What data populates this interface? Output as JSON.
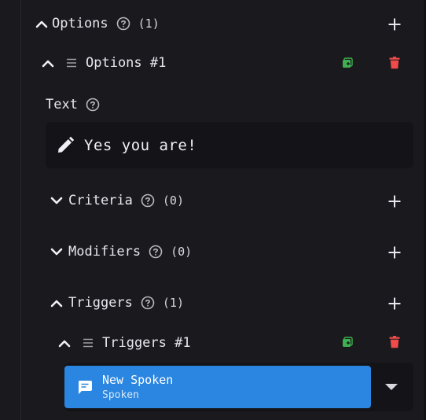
{
  "options": {
    "title": "Options",
    "count": "(1)",
    "icons": {
      "collapse": "chevron-up-icon",
      "help": "help-circle-icon",
      "add": "plus-icon"
    }
  },
  "option_item": {
    "title": "Options #1",
    "icons": {
      "collapse": "chevron-up-icon",
      "drag": "drag-lines-icon",
      "duplicate": "duplicate-icon",
      "delete": "trash-icon"
    },
    "colors": {
      "duplicate": "#3fb04f",
      "delete": "#f04b4b"
    }
  },
  "text_field": {
    "label": "Text",
    "value": "Yes you are!",
    "icon": "pencil-icon"
  },
  "criteria": {
    "title": "Criteria",
    "count": "(0)",
    "icon": "chevron-down-icon"
  },
  "modifiers": {
    "title": "Modifiers",
    "count": "(0)",
    "icon": "chevron-down-icon"
  },
  "triggers": {
    "title": "Triggers",
    "count": "(1)",
    "icon": "chevron-up-icon"
  },
  "trigger_item": {
    "title": "Triggers #1"
  },
  "trigger_card": {
    "title": "New Spoken",
    "subtitle": "Spoken",
    "icon": "chat-message-icon",
    "dropdown_icon": "chevron-down-filled-icon",
    "color": "#2a86e0"
  }
}
